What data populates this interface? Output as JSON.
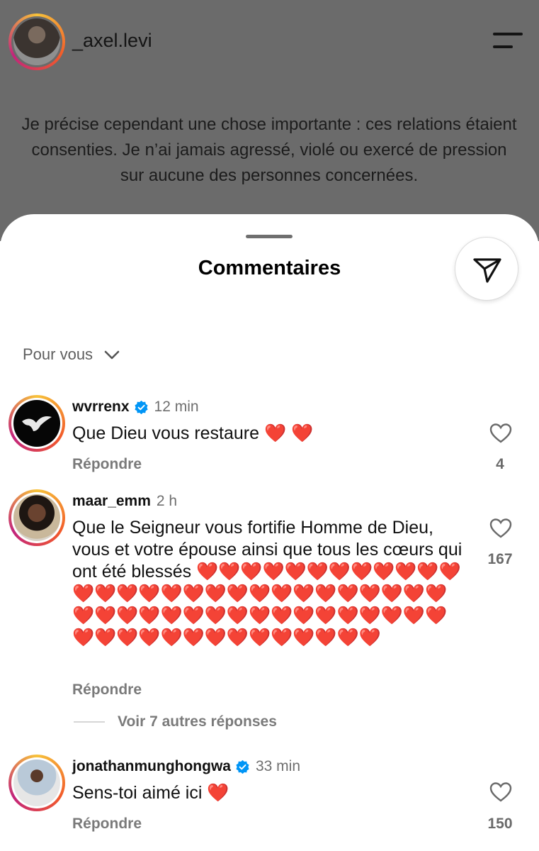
{
  "post": {
    "username": "_axel.levi",
    "caption": "Je précise cependant une chose importante : ces relations étaient consenties. Je n’ai jamais agressé, violé ou exercé de pression sur aucune des personnes concernées."
  },
  "sheet": {
    "title": "Commentaires",
    "sort_label": "Pour vous"
  },
  "comments": [
    {
      "username": "wvrrenx",
      "verified": true,
      "time": "12 min",
      "text": "Que Dieu vous restaure ",
      "hearts": "❤️ ❤️",
      "reply_label": "Répondre",
      "likes": "4"
    },
    {
      "username": "maar_emm",
      "verified": false,
      "time": "2 h",
      "text": "Que le Seigneur vous fortifie Homme de Dieu, vous et votre épouse ainsi que tous les cœurs qui ont été blessés ",
      "hearts": "❤️❤️❤️❤️❤️❤️❤️❤️❤️❤️❤️❤️❤️❤️❤️❤️❤️❤️❤️❤️❤️❤️❤️❤️❤️❤️❤️❤️❤️❤️❤️❤️❤️❤️❤️❤️❤️❤️❤️❤️❤️❤️❤️❤️❤️❤️❤️❤️❤️❤️❤️❤️❤️❤️❤️❤️❤️❤️❤️❤️",
      "reply_label": "Répondre",
      "likes": "167",
      "more_replies": "Voir 7 autres réponses"
    },
    {
      "username": "jonathanmunghongwa",
      "verified": true,
      "time": "33 min",
      "text": "Sens-toi aimé ici ",
      "hearts": "❤️",
      "reply_label": "Répondre",
      "likes": "150"
    }
  ],
  "icons": {
    "menu": "hamburger-menu-icon",
    "share": "paper-plane-icon",
    "sort": "chevron-down-icon",
    "like": "heart-outline-icon",
    "verified": "verified-badge-icon"
  },
  "colors": {
    "heart": "#e3182d",
    "verified": "#0095f6",
    "muted": "#6f6f6f"
  }
}
